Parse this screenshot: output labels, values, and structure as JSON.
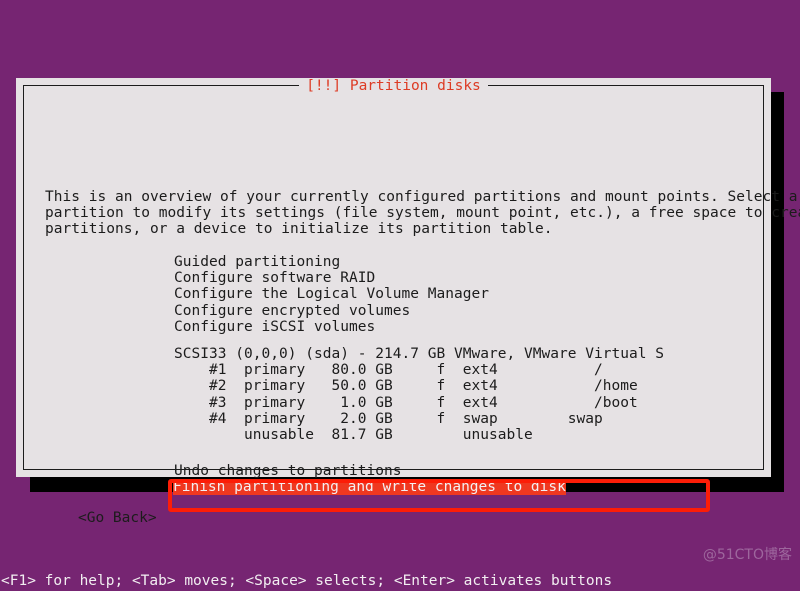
{
  "desktop": {
    "background_color": "#762572",
    "watermark": "@51CTO博客"
  },
  "window": {
    "title": "[!!] Partition disks",
    "title_color": "#dd3b24",
    "background_color": "#e6e2e4",
    "text_color": "#1c1c1c"
  },
  "content": {
    "intro_paragraph": "This is an overview of your currently configured partitions and mount points. Select a\npartition to modify its settings (file system, mount point, etc.), a free space to create\npartitions, or a device to initialize its partition table.",
    "menu_items": [
      "Guided partitioning",
      "Configure software RAID",
      "Configure the Logical Volume Manager",
      "Configure encrypted volumes",
      "Configure iSCSI volumes"
    ],
    "menu_block": "Guided partitioning\nConfigure software RAID\nConfigure the Logical Volume Manager\nConfigure encrypted volumes\nConfigure iSCSI volumes",
    "disk_header": "SCSI33 (0,0,0) (sda) - 214.7 GB VMware, VMware Virtual S",
    "partition_rows": [
      {
        "number": "#1",
        "type": "primary",
        "size": "80.0 GB",
        "flag": "f",
        "filesystem": "ext4",
        "mountpoint": "/"
      },
      {
        "number": "#2",
        "type": "primary",
        "size": "50.0 GB",
        "flag": "f",
        "filesystem": "ext4",
        "mountpoint": "/home"
      },
      {
        "number": "#3",
        "type": "primary",
        "size": "1.0 GB",
        "flag": "f",
        "filesystem": "ext4",
        "mountpoint": "/boot"
      },
      {
        "number": "#4",
        "type": "primary",
        "size": "2.0 GB",
        "flag": "f",
        "filesystem": "swap",
        "mountpoint": "swap"
      },
      {
        "number": "",
        "type": "unusable",
        "size": "81.7 GB",
        "flag": "",
        "filesystem": "unusable",
        "mountpoint": ""
      }
    ],
    "disk_block": "SCSI33 (0,0,0) (sda) - 214.7 GB VMware, VMware Virtual S\n    #1  primary   80.0 GB     f  ext4           /\n    #2  primary   50.0 GB     f  ext4           /home\n    #3  primary    1.0 GB     f  ext4           /boot\n    #4  primary    2.0 GB     f  swap        swap\n        unusable  81.7 GB        unusable",
    "undo_label": "Undo changes to partitions",
    "finish_label": "Finish partitioning and write changes to disk",
    "go_back_label": "<Go Back>"
  },
  "annotation": {
    "color": "#fc1d07",
    "highlight_background": "#ef3820",
    "highlight_text_color": "#f4eff2"
  },
  "status_bar": {
    "text": "<F1> for help; <Tab> moves; <Space> selects; <Enter> activates buttons"
  }
}
